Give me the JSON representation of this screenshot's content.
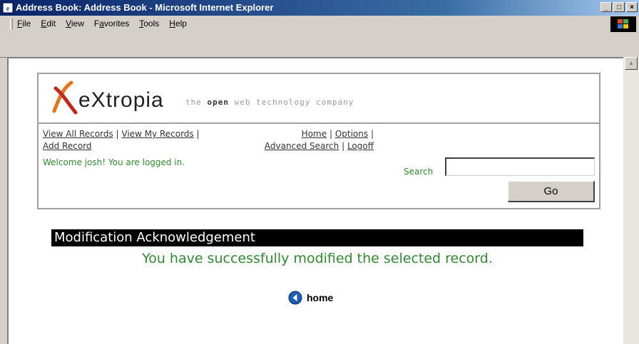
{
  "window": {
    "title": "Address Book: Address Book - Microsoft Internet Explorer",
    "min": "_",
    "max": "□",
    "close": "×"
  },
  "menu": [
    {
      "label": "File",
      "key": "F",
      "rest": "ile"
    },
    {
      "label": "Edit",
      "key": "E",
      "rest": "dit"
    },
    {
      "label": "View",
      "key": "V",
      "rest": "iew"
    },
    {
      "label": "Favorites",
      "key": "a",
      "pre": "F",
      "rest": "vorites"
    },
    {
      "label": "Tools",
      "key": "T",
      "rest": "ools"
    },
    {
      "label": "Help",
      "key": "H",
      "rest": "elp"
    }
  ],
  "logo": {
    "word": "eXtropia",
    "tag_prefix": "the ",
    "tag_bold": "open",
    "tag_suffix": " web technology company"
  },
  "nav": {
    "view_all": "View All Records",
    "view_my": "View My Records",
    "add": "Add Record",
    "home": "Home",
    "options": "Options",
    "advanced": "Advanced Search",
    "logoff": "Logoff",
    "sep": "|"
  },
  "welcome": "Welcome josh! You are logged in.",
  "search": {
    "label": "Search",
    "value": "",
    "go": "Go"
  },
  "ack": {
    "heading": "Modification Acknowledgement",
    "message": "You have successfully modified the selected record."
  },
  "home_link": "home",
  "colors": {
    "green": "#2e8b2e",
    "title_bar": "#0a246a"
  }
}
